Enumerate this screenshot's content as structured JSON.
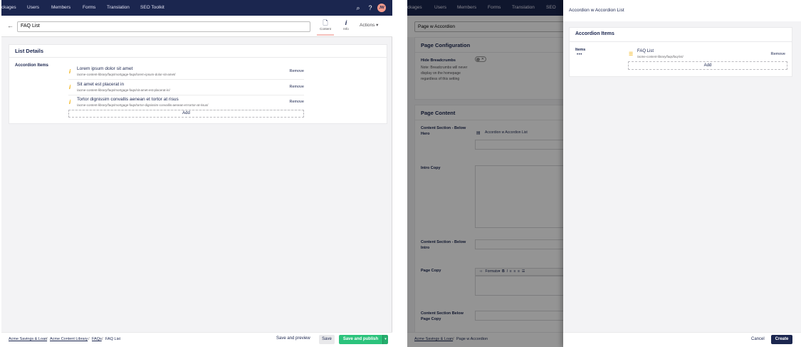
{
  "left": {
    "nav": [
      "ckages",
      "Users",
      "Members",
      "Forms",
      "Translation",
      "SEO Toolkit"
    ],
    "avatar_initials": "JW",
    "content_name": "FAQ List",
    "apps": [
      {
        "label": "Content",
        "icon": "document-icon",
        "glyph": "🗋"
      },
      {
        "label": "Info",
        "icon": "info-icon",
        "glyph": "i"
      }
    ],
    "actions_label": "Actions",
    "card_title": "List Details",
    "property_label": "Accordion Items",
    "items": [
      {
        "name": "Lorem ipsum dolor sit amet",
        "path": "/acme-content-library/faqs/mortgage-faqs/lorem-ipsum-dolor-sit-amet/",
        "remove": "Remove"
      },
      {
        "name": "Sit amet est placerat in",
        "path": "/acme-content-library/faqs/mortgage-faqs/sit-amet-est-placerat-in/",
        "remove": "Remove"
      },
      {
        "name": "Tortor dignissim convallis aenean et tortor at risus",
        "path": "/acme-content-library/faqs/mortgage-faqs/tortor-dignissim-convallis-aenean-et-tortor-at-risus/",
        "remove": "Remove"
      }
    ],
    "add_label": "Add",
    "breadcrumbs": [
      "Acme Savings & Loan",
      "Acme Content Library",
      "FAQs",
      "FAQ List"
    ],
    "save_preview": "Save and preview",
    "save": "Save",
    "save_publish": "Save and publish"
  },
  "right": {
    "nav": [
      "ckages",
      "Users",
      "Members",
      "Forms",
      "Translation",
      "SEO"
    ],
    "content_name": "Page w Accordion",
    "page_config_title": "Page Configuration",
    "hide_breadcrumbs_label": "Hide Breadcrumbs",
    "hide_breadcrumbs_desc": "Note: Breadcrumbs will never display on the homepage regardless of this setting",
    "page_content_title": "Page Content",
    "below_hero_label": "Content Section - Below Hero",
    "picker_item": "Accordion w Accordion List",
    "intro_copy_label": "Intro Copy",
    "below_intro_label": "Content Section - Below Intro",
    "page_copy_label": "Page Copy",
    "formats_label": "Formats",
    "below_page_copy_label": "Content Section Below Page Copy",
    "breadcrumbs": [
      "Acme Savings & Loan",
      "Page w Accordion"
    ]
  },
  "dialog": {
    "title": "Accordion w Accordion List",
    "card_title": "Accordion Items",
    "items_label": "Items",
    "items_dots": "•••",
    "item_name": "FAQ List",
    "item_path": "/acme-content-library/faqs/faq-list/",
    "remove": "Remove",
    "add": "Add",
    "cancel": "Cancel",
    "create": "Create"
  },
  "colors": {
    "nav_bg": "#1b264f",
    "publish_green": "#2bc37c",
    "warning": "#f0ac00",
    "create_bg": "#1b264f"
  }
}
